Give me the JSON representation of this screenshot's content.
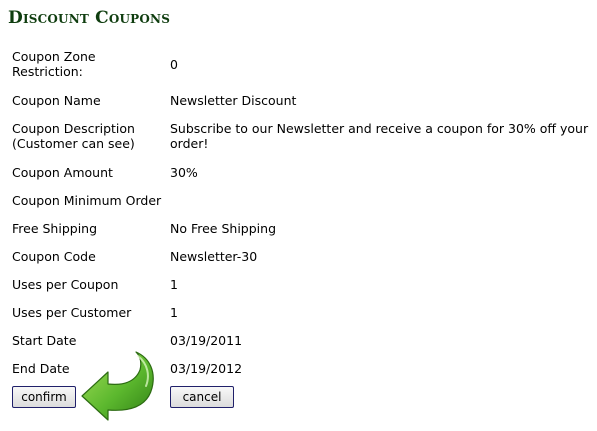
{
  "page": {
    "title": "Discount Coupons"
  },
  "fields": [
    {
      "label": "Coupon Zone\nRestriction:",
      "value": "0"
    },
    {
      "label": "Coupon Name",
      "value": "Newsletter Discount"
    },
    {
      "label": "Coupon Description\n(Customer can see)",
      "value": "Subscribe to our Newsletter and receive a coupon for 30% off your order!"
    },
    {
      "label": "Coupon Amount",
      "value": "30%"
    },
    {
      "label": "Coupon Minimum Order",
      "value": ""
    },
    {
      "label": "Free Shipping",
      "value": "No Free Shipping"
    },
    {
      "label": "Coupon Code",
      "value": "Newsletter-30"
    },
    {
      "label": "Uses per Coupon",
      "value": "1"
    },
    {
      "label": "Uses per Customer",
      "value": "1"
    },
    {
      "label": "Start Date",
      "value": "03/19/2011"
    },
    {
      "label": "End Date",
      "value": "03/19/2012"
    }
  ],
  "buttons": {
    "confirm": "confirm",
    "cancel": "cancel"
  },
  "icons": {
    "pointer": "green-curved-arrow-icon"
  },
  "colors": {
    "title": "#0f3d0f",
    "arrow_green": "#5cb82e",
    "button_border": "#20206a"
  }
}
